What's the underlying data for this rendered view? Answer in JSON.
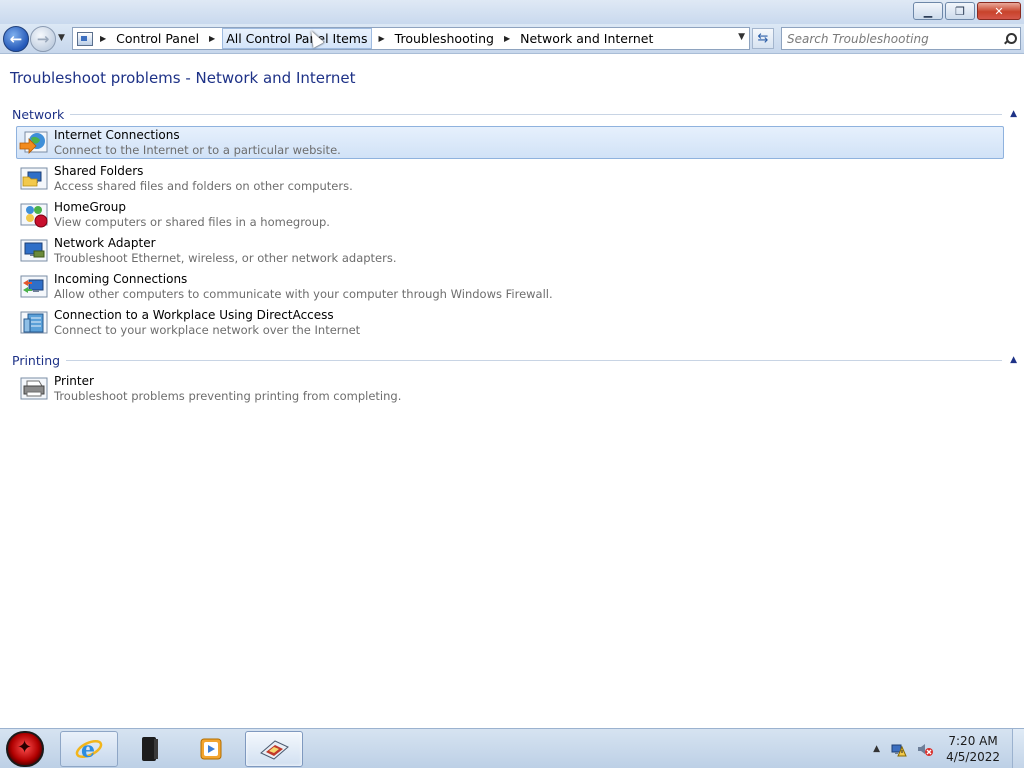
{
  "window": {
    "minimize_icon": "minimize-icon",
    "maximize_icon": "restore-icon",
    "close_icon": "close-icon"
  },
  "navigation": {
    "breadcrumbs": [
      "Control Panel",
      "All Control Panel Items",
      "Troubleshooting",
      "Network and Internet"
    ],
    "search_placeholder": "Search Troubleshooting"
  },
  "page": {
    "title": "Troubleshoot problems - Network and Internet"
  },
  "groups": [
    {
      "title": "Network",
      "items": [
        {
          "title": "Internet Connections",
          "description": "Connect to the Internet or to a particular website.",
          "icon": "internet-connections-icon"
        },
        {
          "title": "Shared Folders",
          "description": "Access shared files and folders on other computers.",
          "icon": "shared-folders-icon"
        },
        {
          "title": "HomeGroup",
          "description": "View computers or shared files in a homegroup.",
          "icon": "homegroup-icon"
        },
        {
          "title": "Network Adapter",
          "description": "Troubleshoot Ethernet, wireless, or other network adapters.",
          "icon": "network-adapter-icon"
        },
        {
          "title": "Incoming Connections",
          "description": "Allow other computers to communicate with your computer through Windows Firewall.",
          "icon": "incoming-connections-icon"
        },
        {
          "title": "Connection to a Workplace Using DirectAccess",
          "description": "Connect to your workplace network over the Internet",
          "icon": "directaccess-icon"
        }
      ]
    },
    {
      "title": "Printing",
      "items": [
        {
          "title": "Printer",
          "description": "Troubleshoot problems preventing printing from completing.",
          "icon": "printer-icon"
        }
      ]
    }
  ],
  "taskbar": {
    "apps": [
      "internet-explorer-icon",
      "media-device-icon",
      "media-player-icon",
      "troubleshooting-window-icon"
    ],
    "clock_time": "7:20 AM",
    "clock_date": "4/5/2022"
  }
}
